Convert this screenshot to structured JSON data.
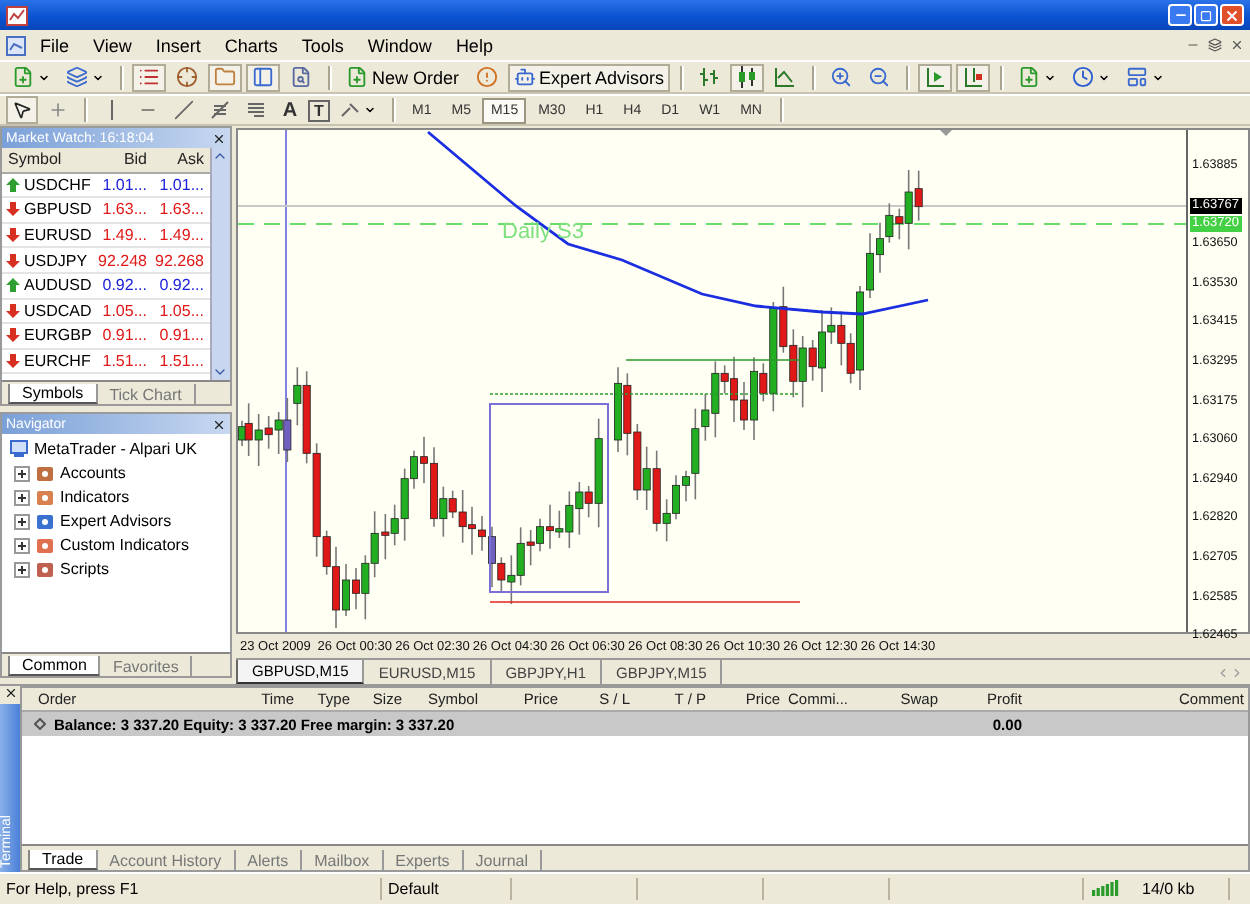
{
  "menu": {
    "items": [
      "File",
      "View",
      "Insert",
      "Charts",
      "Tools",
      "Window",
      "Help"
    ]
  },
  "toolbar": {
    "new_order": "New Order",
    "expert_advisors": "Expert Advisors"
  },
  "drawing_toolbar": {
    "text_tool": "A",
    "label_tool": "T",
    "timeframes": [
      {
        "label": "M1",
        "selected": false
      },
      {
        "label": "M5",
        "selected": false
      },
      {
        "label": "M15",
        "selected": true
      },
      {
        "label": "M30",
        "selected": false
      },
      {
        "label": "H1",
        "selected": false
      },
      {
        "label": "H4",
        "selected": false
      },
      {
        "label": "D1",
        "selected": false
      },
      {
        "label": "W1",
        "selected": false
      },
      {
        "label": "MN",
        "selected": false
      }
    ]
  },
  "market_watch": {
    "title": "Market Watch: 16:18:04",
    "columns": [
      "Symbol",
      "Bid",
      "Ask"
    ],
    "rows": [
      {
        "symbol": "USDCHF",
        "bid": "1.01...",
        "ask": "1.01...",
        "rising": true
      },
      {
        "symbol": "GBPUSD",
        "bid": "1.63...",
        "ask": "1.63...",
        "rising": false
      },
      {
        "symbol": "EURUSD",
        "bid": "1.49...",
        "ask": "1.49...",
        "rising": false
      },
      {
        "symbol": "USDJPY",
        "bid": "92.248",
        "ask": "92.268",
        "rising": false
      },
      {
        "symbol": "AUDUSD",
        "bid": "0.92...",
        "ask": "0.92...",
        "rising": true
      },
      {
        "symbol": "USDCAD",
        "bid": "1.05...",
        "ask": "1.05...",
        "rising": false
      },
      {
        "symbol": "EURGBP",
        "bid": "0.91...",
        "ask": "0.91...",
        "rising": false
      },
      {
        "symbol": "EURCHF",
        "bid": "1.51...",
        "ask": "1.51...",
        "rising": false
      }
    ],
    "tabs": [
      {
        "label": "Symbols",
        "selected": true
      },
      {
        "label": "Tick Chart",
        "selected": false
      }
    ]
  },
  "navigator": {
    "title": "Navigator",
    "root": "MetaTrader - Alpari UK",
    "children": [
      {
        "label": "Accounts",
        "expanded": false
      },
      {
        "label": "Indicators",
        "expanded": false
      },
      {
        "label": "Expert Advisors",
        "expanded": false
      },
      {
        "label": "Custom Indicators",
        "expanded": false
      },
      {
        "label": "Scripts",
        "expanded": false
      }
    ],
    "tabs": [
      {
        "label": "Common",
        "selected": true
      },
      {
        "label": "Favorites",
        "selected": false
      }
    ]
  },
  "chart": {
    "level_label": "Daily S3",
    "current_price": "1.63767",
    "level_price": "1.63720",
    "price_ticks": [
      "1.63885",
      "1.63650",
      "1.63530",
      "1.63415",
      "1.63295",
      "1.63175",
      "1.63060",
      "1.62940",
      "1.62820",
      "1.62705",
      "1.62585",
      "1.62465"
    ],
    "time_labels": [
      "23 Oct 2009",
      "26 Oct 00:30",
      "26 Oct 02:30",
      "26 Oct 04:30",
      "26 Oct 06:30",
      "26 Oct 08:30",
      "26 Oct 10:30",
      "26 Oct 12:30",
      "26 Oct 14:30"
    ],
    "tabs": [
      {
        "label": "GBPUSD,M15",
        "selected": true
      },
      {
        "label": "EURUSD,M15",
        "selected": false
      },
      {
        "label": "GBPJPY,H1",
        "selected": false
      },
      {
        "label": "GBPJPY,M15",
        "selected": false
      }
    ]
  },
  "terminal": {
    "title": "Terminal",
    "columns": [
      "Order",
      "Time",
      "Type",
      "Size",
      "Symbol",
      "Price",
      "S / L",
      "T / P",
      "Price",
      "Commi...",
      "Swap",
      "Profit",
      "Comment"
    ],
    "summary": "Balance: 3 337.20  Equity: 3 337.20  Free margin: 3 337.20",
    "profit": "0.00",
    "tabs": [
      {
        "label": "Trade",
        "selected": true
      },
      {
        "label": "Account History",
        "selected": false
      },
      {
        "label": "Alerts",
        "selected": false
      },
      {
        "label": "Mailbox",
        "selected": false
      },
      {
        "label": "Experts",
        "selected": false
      },
      {
        "label": "Journal",
        "selected": false
      }
    ]
  },
  "status_bar": {
    "help": "For Help, press F1",
    "profile": "Default",
    "traffic": "14/0 kb"
  }
}
